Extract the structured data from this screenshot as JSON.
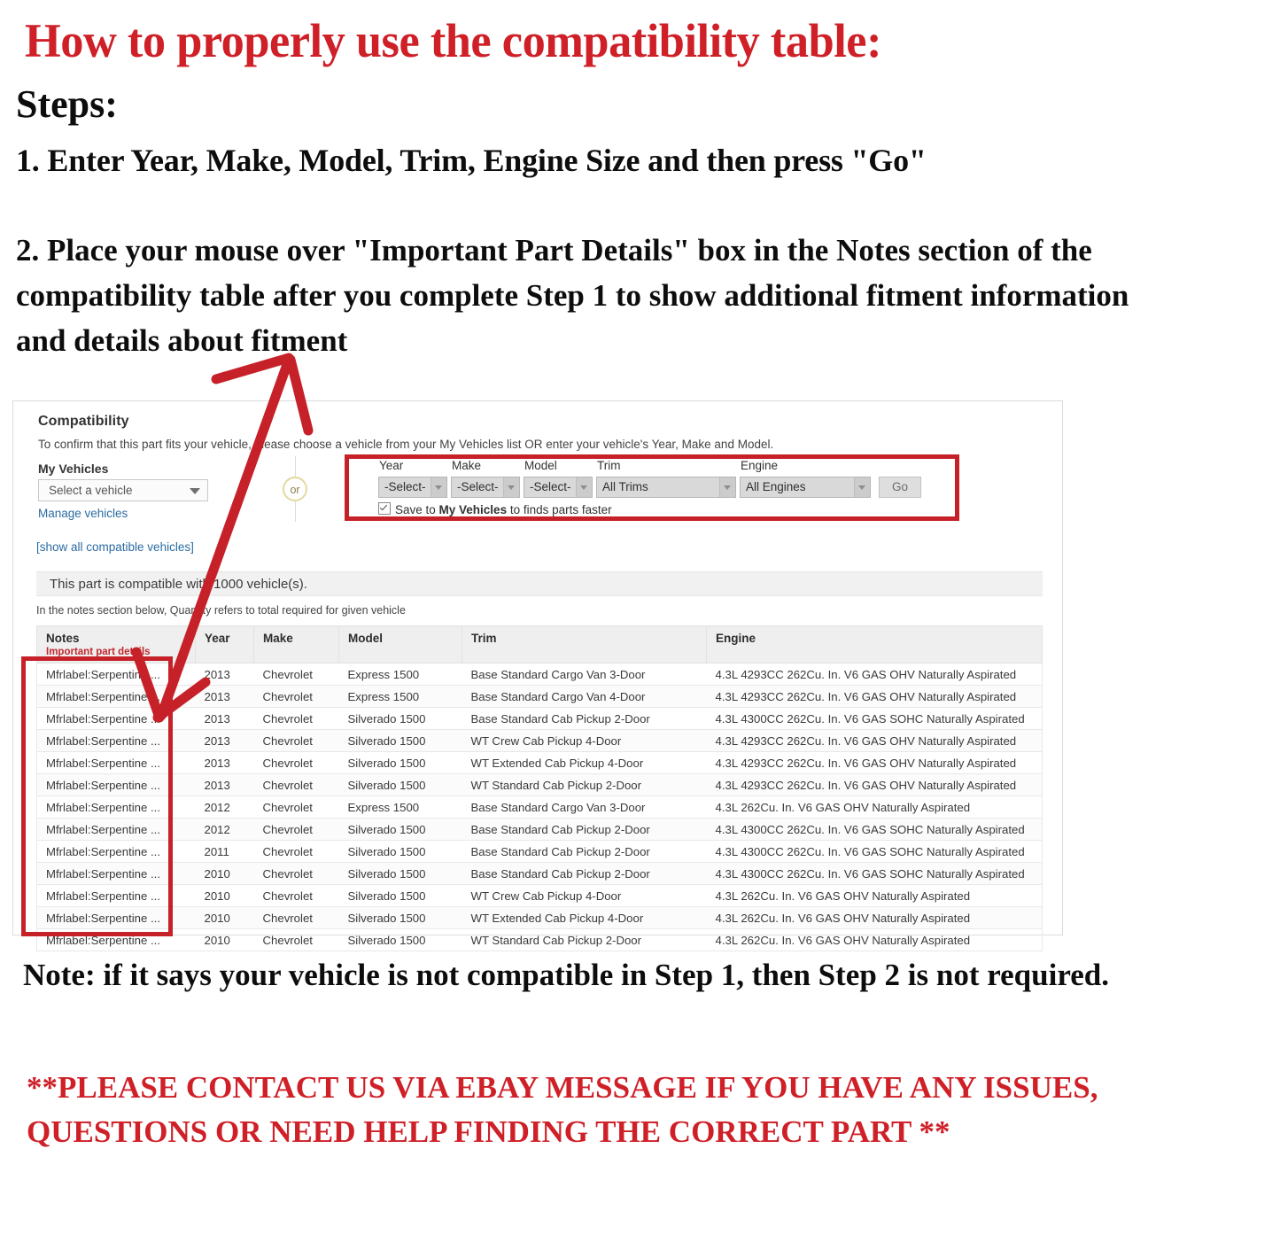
{
  "instructions": {
    "headline": "How to properly use the compatibility table:",
    "steps_label": "Steps:",
    "step1": "1. Enter Year, Make, Model, Trim, Engine Size and then press \"Go\"",
    "step2": "2. Place your mouse over \"Important Part Details\" box in the Notes section of the compatibility table after you complete Step 1 to show additional fitment information and details about fitment",
    "bottom_note": "Note: if it says your vehicle is not compatible in Step 1, then Step 2 is not required.",
    "contact_note": "**PLEASE CONTACT US VIA EBAY MESSAGE IF YOU HAVE ANY ISSUES, QUESTIONS OR NEED HELP FINDING THE CORRECT PART **"
  },
  "colors": {
    "headline_red": "#cf2028",
    "highlight_red": "#c62128",
    "link_blue": "#2b6ca3",
    "notes_sub_red": "#c0282c"
  },
  "panel": {
    "title": "Compatibility",
    "subtitle": "To confirm that this part fits your vehicle, please choose a vehicle from your My Vehicles list OR enter your vehicle's Year, Make and Model.",
    "my_vehicles_label": "My Vehicles",
    "vehicle_select_value": "Select a vehicle",
    "manage_vehicles_link": "Manage vehicles",
    "show_all_link": "[show all compatible vehicles]",
    "or_divider": "or",
    "compatible_banner": "This part is compatible with 1000 vehicle(s).",
    "quantity_note": "In the notes section below, Quantity refers to total required for given vehicle",
    "form": {
      "fields": [
        {
          "label": "Year",
          "value": "-Select-"
        },
        {
          "label": "Make",
          "value": "-Select-"
        },
        {
          "label": "Model",
          "value": "-Select-"
        },
        {
          "label": "Trim",
          "value": "All Trims"
        },
        {
          "label": "Engine",
          "value": "All Engines"
        }
      ],
      "go_label": "Go",
      "save_prefix": "Save to ",
      "save_bold": "My Vehicles",
      "save_suffix": " to finds parts faster",
      "save_checked": true
    }
  },
  "table": {
    "headers": {
      "notes": "Notes",
      "notes_sub": "Important part details",
      "year": "Year",
      "make": "Make",
      "model": "Model",
      "trim": "Trim",
      "engine": "Engine"
    },
    "rows": [
      {
        "notes": "Mfrlabel:Serpentine ...",
        "year": "2013",
        "make": "Chevrolet",
        "model": "Express 1500",
        "trim": "Base Standard Cargo Van 3-Door",
        "engine": "4.3L 4293CC 262Cu. In. V6 GAS OHV Naturally Aspirated"
      },
      {
        "notes": "Mfrlabel:Serpentine ...",
        "year": "2013",
        "make": "Chevrolet",
        "model": "Express 1500",
        "trim": "Base Standard Cargo Van 4-Door",
        "engine": "4.3L 4293CC 262Cu. In. V6 GAS OHV Naturally Aspirated"
      },
      {
        "notes": "Mfrlabel:Serpentine ...",
        "year": "2013",
        "make": "Chevrolet",
        "model": "Silverado 1500",
        "trim": "Base Standard Cab Pickup 2-Door",
        "engine": "4.3L 4300CC 262Cu. In. V6 GAS SOHC Naturally Aspirated"
      },
      {
        "notes": "Mfrlabel:Serpentine ...",
        "year": "2013",
        "make": "Chevrolet",
        "model": "Silverado 1500",
        "trim": "WT Crew Cab Pickup 4-Door",
        "engine": "4.3L 4293CC 262Cu. In. V6 GAS OHV Naturally Aspirated"
      },
      {
        "notes": "Mfrlabel:Serpentine ...",
        "year": "2013",
        "make": "Chevrolet",
        "model": "Silverado 1500",
        "trim": "WT Extended Cab Pickup 4-Door",
        "engine": "4.3L 4293CC 262Cu. In. V6 GAS OHV Naturally Aspirated"
      },
      {
        "notes": "Mfrlabel:Serpentine ...",
        "year": "2013",
        "make": "Chevrolet",
        "model": "Silverado 1500",
        "trim": "WT Standard Cab Pickup 2-Door",
        "engine": "4.3L 4293CC 262Cu. In. V6 GAS OHV Naturally Aspirated"
      },
      {
        "notes": "Mfrlabel:Serpentine ...",
        "year": "2012",
        "make": "Chevrolet",
        "model": "Express 1500",
        "trim": "Base Standard Cargo Van 3-Door",
        "engine": "4.3L 262Cu. In. V6 GAS OHV Naturally Aspirated"
      },
      {
        "notes": "Mfrlabel:Serpentine ...",
        "year": "2012",
        "make": "Chevrolet",
        "model": "Silverado 1500",
        "trim": "Base Standard Cab Pickup 2-Door",
        "engine": "4.3L 4300CC 262Cu. In. V6 GAS SOHC Naturally Aspirated"
      },
      {
        "notes": "Mfrlabel:Serpentine ...",
        "year": "2011",
        "make": "Chevrolet",
        "model": "Silverado 1500",
        "trim": "Base Standard Cab Pickup 2-Door",
        "engine": "4.3L 4300CC 262Cu. In. V6 GAS SOHC Naturally Aspirated"
      },
      {
        "notes": "Mfrlabel:Serpentine ...",
        "year": "2010",
        "make": "Chevrolet",
        "model": "Silverado 1500",
        "trim": "Base Standard Cab Pickup 2-Door",
        "engine": "4.3L 4300CC 262Cu. In. V6 GAS SOHC Naturally Aspirated"
      },
      {
        "notes": "Mfrlabel:Serpentine ...",
        "year": "2010",
        "make": "Chevrolet",
        "model": "Silverado 1500",
        "trim": "WT Crew Cab Pickup 4-Door",
        "engine": "4.3L 262Cu. In. V6 GAS OHV Naturally Aspirated"
      },
      {
        "notes": "Mfrlabel:Serpentine ...",
        "year": "2010",
        "make": "Chevrolet",
        "model": "Silverado 1500",
        "trim": "WT Extended Cab Pickup 4-Door",
        "engine": "4.3L 262Cu. In. V6 GAS OHV Naturally Aspirated"
      },
      {
        "notes": "Mfrlabel:Serpentine ...",
        "year": "2010",
        "make": "Chevrolet",
        "model": "Silverado 1500",
        "trim": "WT Standard Cab Pickup 2-Door",
        "engine": "4.3L 262Cu. In. V6 GAS OHV Naturally Aspirated"
      }
    ]
  }
}
